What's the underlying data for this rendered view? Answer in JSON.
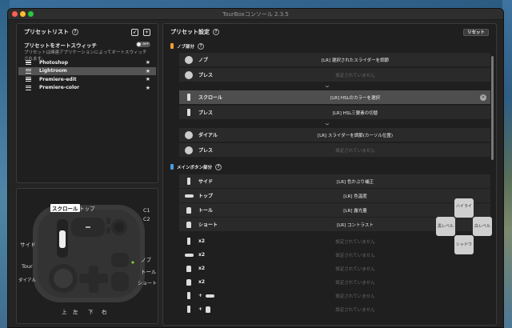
{
  "window": {
    "title": "TourBoxコンソール 2.3.5"
  },
  "preset_list": {
    "title": "プリセットリスト",
    "auto_switch_label": "プリセットをオートスウィッチ",
    "toggle_text": "OFF",
    "auto_switch_desc": "プリセットは関連アプリケーションによってオートスウィッチされます。",
    "items": [
      {
        "name": "Photoshop",
        "selected": false
      },
      {
        "name": "Lightroom",
        "selected": true
      },
      {
        "name": "Premiere-edit",
        "selected": false
      },
      {
        "name": "Premiere-color",
        "selected": false
      }
    ]
  },
  "device": {
    "labels": {
      "scroll": "スクロール",
      "top": "トップ",
      "c1": "C1",
      "c2": "C2",
      "side": "サイド",
      "knob": "ノブ",
      "tour": "Tour",
      "tall": "トール",
      "dial": "ダイアル",
      "short": "ショート",
      "up": "上",
      "left": "左",
      "down": "下",
      "right": "右"
    }
  },
  "settings": {
    "title": "プリセット設定",
    "reset_label": "リセット",
    "knob_section": "ノブ部分",
    "main_section": "メインボタン部分",
    "rows": {
      "knob_turn": {
        "label": "ノブ",
        "value": "[LR] 選択されたスライダーを調節"
      },
      "knob_press": {
        "label": "プレス",
        "value": "設定されていません"
      },
      "scroll_turn": {
        "label": "スクロール",
        "value": "[LR] HSLのカラーを選択"
      },
      "scroll_press": {
        "label": "プレス",
        "value": "[LR] HSL三要素の切替"
      },
      "dial_turn": {
        "label": "ダイアル",
        "value": "[LR] スライダーを調節(カーソル位置)"
      },
      "dial_press": {
        "label": "プレス",
        "value": "設定されていません"
      },
      "side": {
        "label": "サイド",
        "value": "[LR] 色かぶり補正"
      },
      "top": {
        "label": "トップ",
        "value": "[LR] 色温度"
      },
      "tall": {
        "label": "トール",
        "value": "[LR] 露光量"
      },
      "short": {
        "label": "ショート",
        "value": "[LR] コントラスト"
      },
      "x2a": {
        "label": "x2",
        "value": "設定されていません"
      },
      "x2b": {
        "label": "x2",
        "value": "設定されていません"
      },
      "x2c": {
        "label": "x2",
        "value": "設定されていません"
      },
      "x2d": {
        "label": "x2",
        "value": "設定されていません"
      },
      "combo1": {
        "label": "+",
        "value": "設定されていません"
      },
      "combo2": {
        "label": "+",
        "value": "設定されていません"
      }
    }
  },
  "dpad": {
    "up": "ハイライト",
    "left": "黒レベル",
    "right": "白レベル",
    "down": "シャドウ"
  },
  "colors": {
    "knob_section_marker": "#f0a030",
    "main_section_marker": "#4a9de0",
    "selected_row": "#4e4e4e"
  }
}
